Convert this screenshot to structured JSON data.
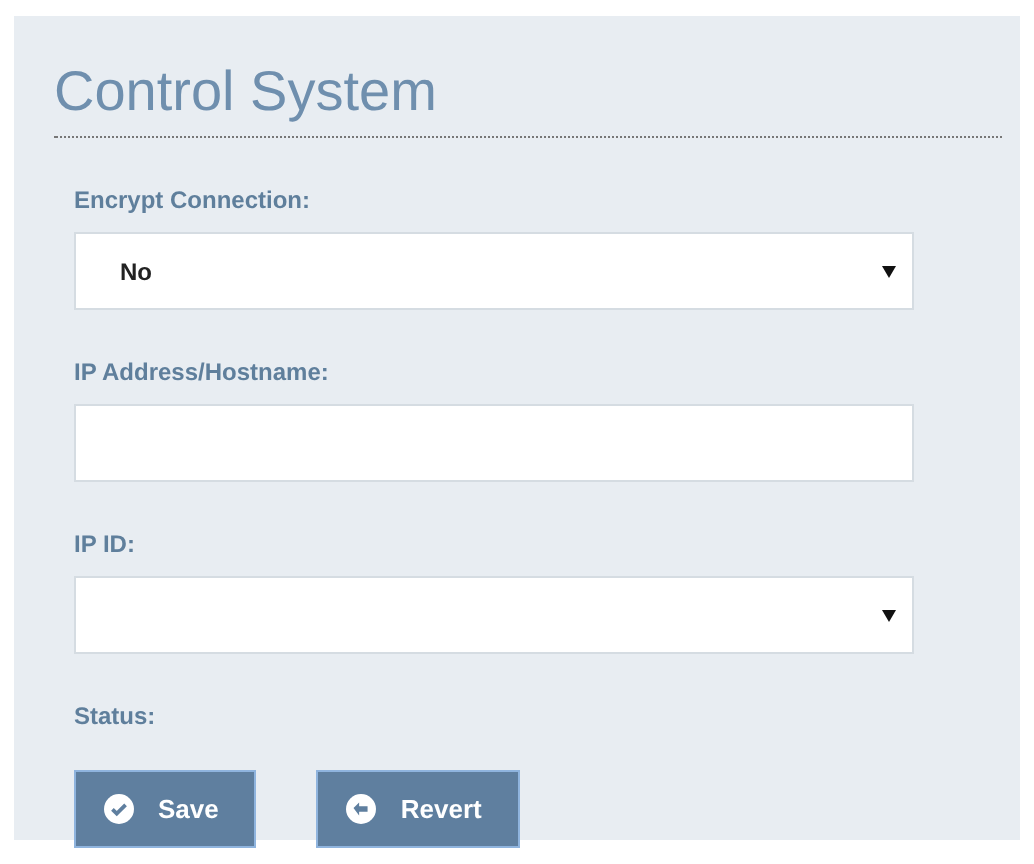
{
  "title": "Control System",
  "fields": [
    {
      "kind": "select",
      "label": "Encrypt Connection:",
      "value": "No"
    },
    {
      "kind": "text",
      "label": "IP Address/Hostname:"
    },
    {
      "kind": "select",
      "label": "IP ID:"
    }
  ],
  "status": {
    "label": "Status:"
  },
  "buttons": [
    {
      "kind": "save",
      "label": "Save"
    },
    {
      "kind": "revert",
      "label": "Revert"
    }
  ]
}
